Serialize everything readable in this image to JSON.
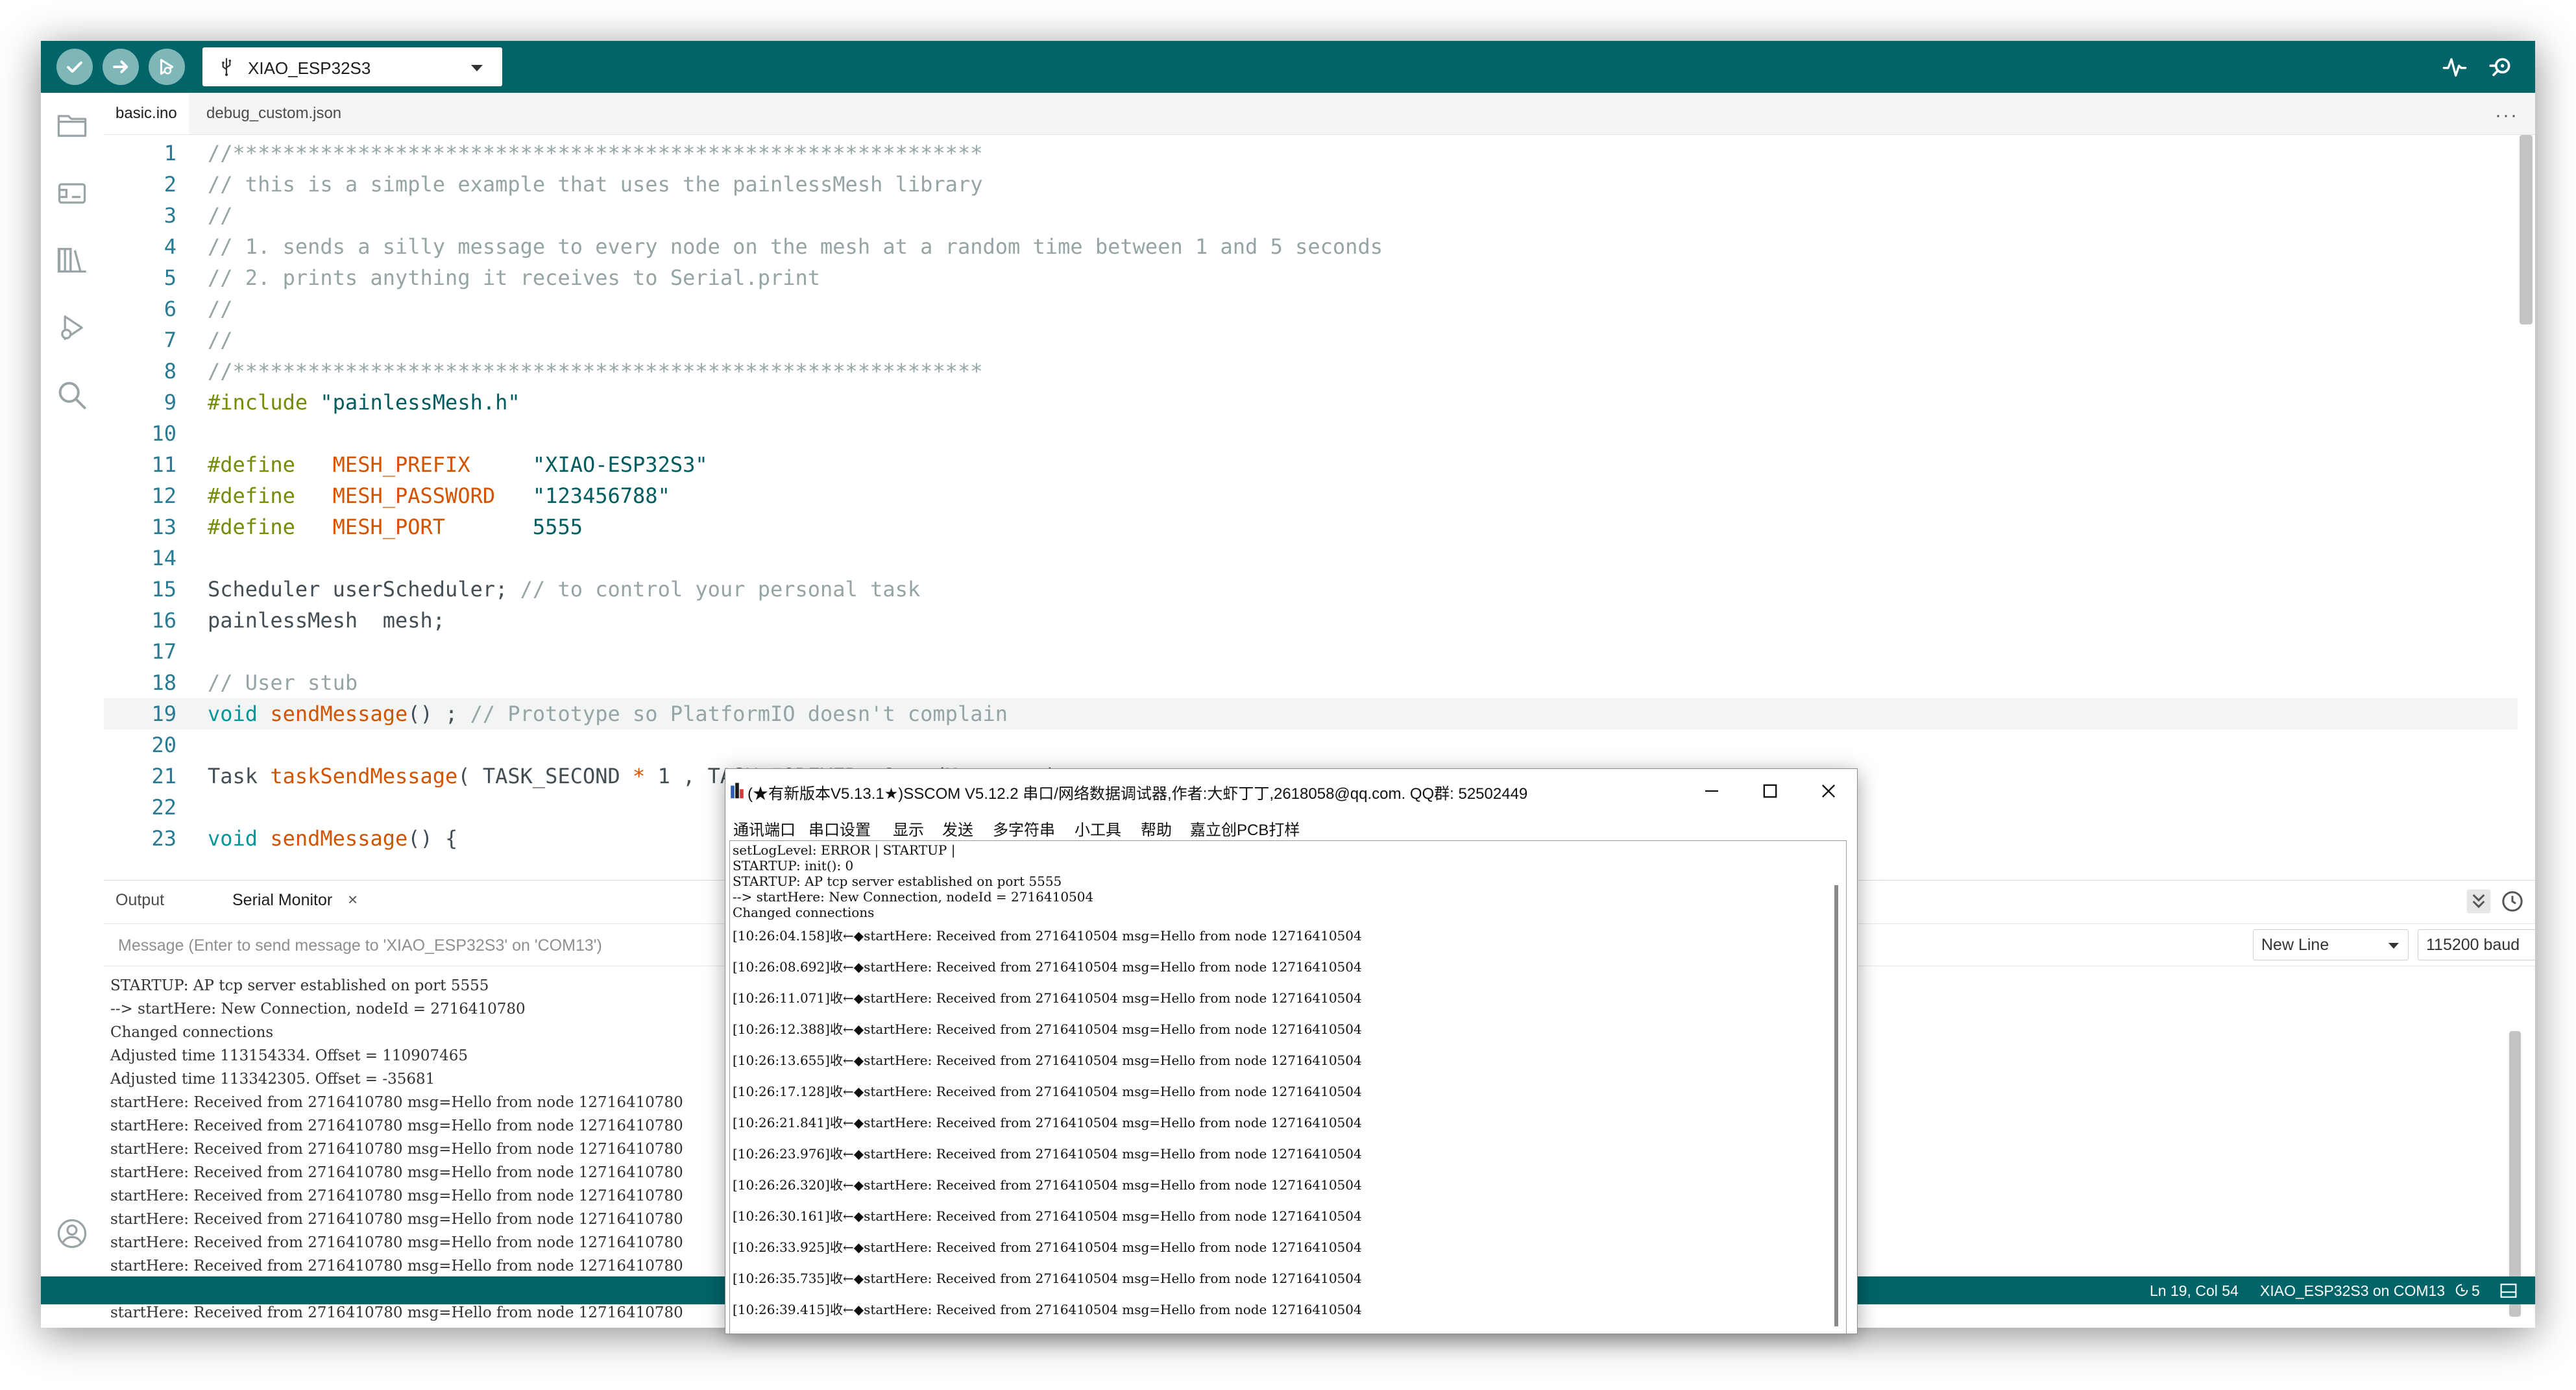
{
  "toolbar": {
    "verify_icon": "checkmark-icon",
    "upload_icon": "arrow-right-icon",
    "debug_icon": "debug-icon",
    "board": "XIAO_ESP32S3",
    "serial_plotter_icon": "pulse-icon",
    "serial_monitor_icon": "magnifier-icon"
  },
  "sidebar": {
    "items": [
      "folder-icon",
      "board-icon",
      "library-icon",
      "debug-icon",
      "search-icon"
    ],
    "bottom": "user-icon"
  },
  "tabs": [
    {
      "label": "basic.ino",
      "active": true
    },
    {
      "label": "debug_custom.json",
      "active": false
    }
  ],
  "more_label": "···",
  "editor": {
    "current_line": 19,
    "lines": [
      {
        "n": "1",
        "parts": [
          [
            "c",
            "//************************************************************"
          ]
        ]
      },
      {
        "n": "2",
        "parts": [
          [
            "c",
            "// this is a simple example that uses the painlessMesh library"
          ]
        ]
      },
      {
        "n": "3",
        "parts": [
          [
            "c",
            "//"
          ]
        ]
      },
      {
        "n": "4",
        "parts": [
          [
            "c",
            "// 1. sends a silly message to every node on the mesh at a random time between 1 and 5 seconds"
          ]
        ]
      },
      {
        "n": "5",
        "parts": [
          [
            "c",
            "// 2. prints anything it receives to Serial.print"
          ]
        ]
      },
      {
        "n": "6",
        "parts": [
          [
            "c",
            "//"
          ]
        ]
      },
      {
        "n": "7",
        "parts": [
          [
            "c",
            "//"
          ]
        ]
      },
      {
        "n": "8",
        "parts": [
          [
            "c",
            "//************************************************************"
          ]
        ]
      },
      {
        "n": "9",
        "parts": [
          [
            "pp",
            "#include"
          ],
          [
            "",
            " "
          ],
          [
            "str",
            "\"painlessMesh.h\""
          ]
        ]
      },
      {
        "n": "10",
        "parts": []
      },
      {
        "n": "11",
        "parts": [
          [
            "pp",
            "#define"
          ],
          [
            "",
            "   "
          ],
          [
            "mac",
            "MESH_PREFIX"
          ],
          [
            "",
            "     "
          ],
          [
            "str",
            "\"XIAO-ESP32S3\""
          ]
        ]
      },
      {
        "n": "12",
        "parts": [
          [
            "pp",
            "#define"
          ],
          [
            "",
            "   "
          ],
          [
            "mac",
            "MESH_PASSWORD"
          ],
          [
            "",
            "   "
          ],
          [
            "str",
            "\"123456788\""
          ]
        ]
      },
      {
        "n": "13",
        "parts": [
          [
            "pp",
            "#define"
          ],
          [
            "",
            "   "
          ],
          [
            "mac",
            "MESH_PORT"
          ],
          [
            "",
            "       "
          ],
          [
            "str",
            "5555"
          ]
        ]
      },
      {
        "n": "14",
        "parts": []
      },
      {
        "n": "15",
        "parts": [
          [
            "",
            "Scheduler userScheduler; "
          ],
          [
            "c",
            "// to control your personal task"
          ]
        ]
      },
      {
        "n": "16",
        "parts": [
          [
            "",
            "painlessMesh  mesh;"
          ]
        ]
      },
      {
        "n": "17",
        "parts": []
      },
      {
        "n": "18",
        "parts": [
          [
            "c",
            "// User stub"
          ]
        ]
      },
      {
        "n": "19",
        "parts": [
          [
            "kw",
            "void"
          ],
          [
            "",
            " "
          ],
          [
            "fn",
            "sendMessage"
          ],
          [
            "",
            "() ; "
          ],
          [
            "c",
            "// Prototype so PlatformIO doesn't complain"
          ]
        ]
      },
      {
        "n": "20",
        "parts": []
      },
      {
        "n": "21",
        "parts": [
          [
            "",
            "Task "
          ],
          [
            "fn",
            "taskSendMessage"
          ],
          [
            "",
            "( TASK_SECOND "
          ],
          [
            "op",
            "*"
          ],
          [
            "",
            " 1 , TASK_FOREVER, &sendMessage );"
          ]
        ]
      },
      {
        "n": "22",
        "parts": []
      },
      {
        "n": "23",
        "parts": [
          [
            "kw",
            "void"
          ],
          [
            "",
            " "
          ],
          [
            "fn",
            "sendMessage"
          ],
          [
            "",
            "() {"
          ]
        ]
      }
    ]
  },
  "panel": {
    "tab_output": "Output",
    "tab_serial": "Serial Monitor",
    "close": "×",
    "message_placeholder": "Message (Enter to send message to 'XIAO_ESP32S3' on 'COM13')",
    "line_ending": "New Line",
    "baud": "115200 baud",
    "output_lines": [
      "STARTUP: AP tcp server established on port 5555",
      "--> startHere: New Connection, nodeId = 2716410780",
      "Changed connections",
      "Adjusted time 113154334. Offset = 110907465",
      "Adjusted time 113342305. Offset = -35681",
      "startHere: Received from 2716410780 msg=Hello from node 12716410780",
      "startHere: Received from 2716410780 msg=Hello from node 12716410780",
      "startHere: Received from 2716410780 msg=Hello from node 12716410780",
      "startHere: Received from 2716410780 msg=Hello from node 12716410780",
      "startHere: Received from 2716410780 msg=Hello from node 12716410780",
      "startHere: Received from 2716410780 msg=Hello from node 12716410780",
      "startHere: Received from 2716410780 msg=Hello from node 12716410780",
      "startHere: Received from 2716410780 msg=Hello from node 12716410780",
      "startHere: Received from 2716410780 msg=Hello from node 12716410780",
      "startHere: Received from 2716410780 msg=Hello from node 12716410780"
    ]
  },
  "status": {
    "position": "Ln 19, Col 54",
    "board_port": "XIAO_ESP32S3 on COM13",
    "notifications": "5"
  },
  "sscom": {
    "title": "(★有新版本V5.13.1★)SSCOM V5.12.2 串口/网络数据调试器,作者:大虾丁丁,2618058@qq.com. QQ群: 52502449",
    "menu": [
      "通讯端口",
      "串口设置",
      "显示",
      "发送",
      "多字符串",
      "小工具",
      "帮助",
      "嘉立创PCB打样"
    ],
    "header_lines": [
      "setLogLevel: ERROR | STARTUP |",
      "STARTUP: init(): 0",
      "STARTUP: AP tcp server established on port 5555",
      "--> startHere: New Connection, nodeId = 2716410504",
      "Changed connections"
    ],
    "rx_lines": [
      "[10:26:04.158]收←◆startHere: Received from 2716410504 msg=Hello from node 12716410504",
      "[10:26:08.692]收←◆startHere: Received from 2716410504 msg=Hello from node 12716410504",
      "[10:26:11.071]收←◆startHere: Received from 2716410504 msg=Hello from node 12716410504",
      "[10:26:12.388]收←◆startHere: Received from 2716410504 msg=Hello from node 12716410504",
      "[10:26:13.655]收←◆startHere: Received from 2716410504 msg=Hello from node 12716410504",
      "[10:26:17.128]收←◆startHere: Received from 2716410504 msg=Hello from node 12716410504",
      "[10:26:21.841]收←◆startHere: Received from 2716410504 msg=Hello from node 12716410504",
      "[10:26:23.976]收←◆startHere: Received from 2716410504 msg=Hello from node 12716410504",
      "[10:26:26.320]收←◆startHere: Received from 2716410504 msg=Hello from node 12716410504",
      "[10:26:30.161]收←◆startHere: Received from 2716410504 msg=Hello from node 12716410504",
      "[10:26:33.925]收←◆startHere: Received from 2716410504 msg=Hello from node 12716410504",
      "[10:26:35.735]收←◆startHere: Received from 2716410504 msg=Hello from node 12716410504",
      "[10:26:39.415]收←◆startHere: Received from 2716410504 msg=Hello from node 12716410504"
    ]
  },
  "colors": {
    "toolbar": "#006468",
    "toolbar_button": "#7fb6b8",
    "comment": "#95a5a6",
    "preprocessor": "#728e00",
    "macro": "#d35400",
    "line_number": "#2a7a93"
  }
}
